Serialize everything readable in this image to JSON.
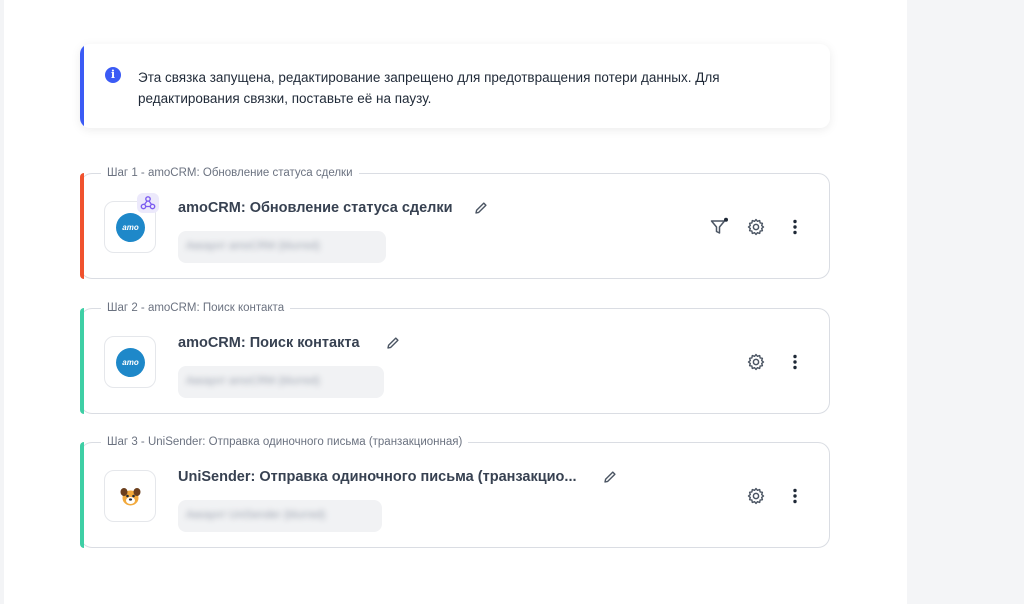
{
  "info_banner": {
    "text": "Эта связка запущена, редактирование запрещено для предотвращения потери данных. Для редактирования связки, поставьте её на паузу.",
    "icon": "info-icon",
    "accent_color": "#3b5bf5"
  },
  "steps": [
    {
      "caption": "Шаг 1 - amoCRM: Обновление статуса сделки",
      "title": "amoCRM: Обновление статуса сделки",
      "logo_text": "amo",
      "account": "Аккаунт amoCRM (blurred)",
      "accent_color": "#f0522e",
      "has_filter": true,
      "has_webhook_badge": true
    },
    {
      "caption": "Шаг 2 - amoCRM: Поиск контакта",
      "title": "amoCRM: Поиск контакта",
      "logo_text": "amo",
      "account": "Аккаунт amoCRM (blurred)",
      "accent_color": "#3ecfa5",
      "has_filter": false,
      "has_webhook_badge": false
    },
    {
      "caption": "Шаг 3 - UniSender: Отправка одиночного письма (транзакционная)",
      "title": "UniSender: Отправка одиночного письма (транзакцио...",
      "account": "Аккаунт UniSender (blurred)",
      "accent_color": "#3ecfa5",
      "has_filter": false,
      "has_webhook_badge": false
    }
  ]
}
